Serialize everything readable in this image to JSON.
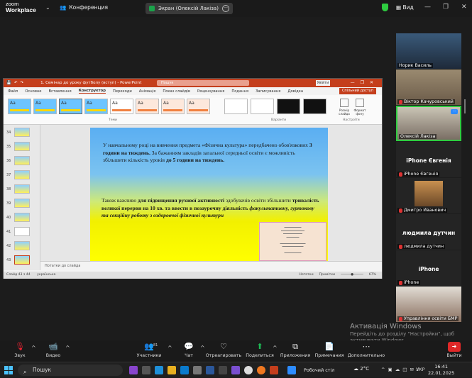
{
  "app": {
    "logo_line1": "zoom",
    "logo_line2": "Workplace",
    "meeting_label": "Конференция",
    "share_label": "Экран (Олексій Лакіза)",
    "view_label": "Вид"
  },
  "ppt": {
    "title": "1. Семінар до уроку футболу (вступ) - PowerPoint",
    "search_placeholder": "Пошук",
    "signin": "Увійти",
    "menu": [
      "Файл",
      "Основне",
      "Вставлення",
      "Конструктор",
      "Переходи",
      "Анімація",
      "Показ слайдів",
      "Рецензування",
      "Подання",
      "Записування",
      "Довідка"
    ],
    "active_menu": "Конструктор",
    "share_button": "Спільний доступ",
    "group_themes": "Теми",
    "group_variants": "Варіанти",
    "group_customize": "Настроїти",
    "btn_slide_size": "Розмір слайда",
    "btn_format_bg": "Формат фону",
    "theme_label": "Aa",
    "thumbs": [
      "34",
      "35",
      "36",
      "37",
      "38",
      "39",
      "40",
      "41",
      "42",
      "43"
    ],
    "notes_placeholder": "Нотатки до слайда",
    "status_left": "Слайд 43 з 44",
    "status_lang": "українська",
    "status_notes": "Нотатки",
    "status_comments": "Примітки",
    "zoom": "67%",
    "slide": {
      "p1_a": "У навчальному році на вивчення предмета «Фізична культура» передбачено обов'язкових ",
      "p1_b": "3 години на тиждень.",
      "p1_c": " За бажанням закладів загальної середньої освіти є можливість збільшити кількість уроків ",
      "p1_d": "до 5 години на тиждень.",
      "p2_a": "Також важливо ",
      "p2_b": "для підвищення рухової активності",
      "p2_c": " здобувачів освіти збільшити ",
      "p2_d": "тривалість великої перерви на 10 хв. та ввести в позаурочну діяльність ",
      "p2_e": "факультативну, гуртокову та секційну роботу з оздоровчої фізичної культури"
    }
  },
  "participants": [
    {
      "name": "Норик Василь",
      "muted": false
    },
    {
      "name": "Віктор Качуровський",
      "muted": true
    },
    {
      "name": "Олексій Лакіза",
      "muted": false
    },
    {
      "name": "iPhone Євгенія",
      "label": "iPhone Євгенія",
      "muted": true
    },
    {
      "name": "Дмитро Иванович",
      "muted": true
    },
    {
      "name": "людмила дутчин",
      "label": "людмила дутчин",
      "muted": true
    },
    {
      "name": "iPhone",
      "label": "iPhone",
      "muted": true
    },
    {
      "name": "Управління освіти БМР",
      "muted": true
    }
  ],
  "watermark": {
    "title": "Активація Windows",
    "sub": "Перейдіть до розділу \"Настройки\", щоб активувати Windows."
  },
  "toolbar": {
    "audio": "Звук",
    "video": "Видео",
    "participants": "Участники",
    "participants_count": "81",
    "chat": "Чат",
    "react": "Отреагировать",
    "share": "Поделиться",
    "apps": "Приложения",
    "notes": "Примечания",
    "more": "Дополнительно",
    "leave": "Выйти"
  },
  "taskbar": {
    "search": "Пошук",
    "app": "Робочий стіл",
    "weather": "2°C",
    "lang": "УКР",
    "time": "16:41",
    "date": "22.01.2025"
  },
  "colors": {
    "ppt_accent": "#c43e1c",
    "zoom_green": "#1aa34a",
    "active_border": "#2ecc40"
  }
}
